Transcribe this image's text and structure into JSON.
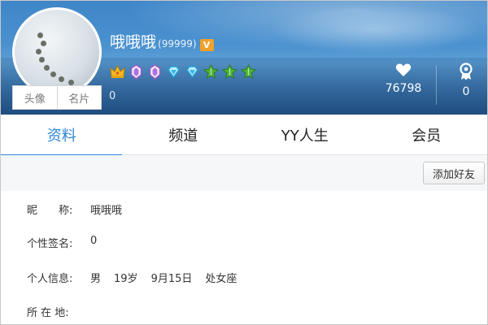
{
  "profile": {
    "username": "哦哦哦",
    "yy_number": "(99999)",
    "v_badge": "V",
    "avatar_tabs": [
      "头像",
      "名片"
    ],
    "left_count": "0",
    "badges": [
      "crown-icon",
      "purple-gem-icon",
      "purple-gem-icon",
      "blue-diamond-icon",
      "blue-diamond-icon",
      "green-leaf-icon",
      "green-leaf-icon",
      "green-leaf-icon"
    ],
    "likes": "76798",
    "medals": "0"
  },
  "tabs": [
    "资料",
    "频道",
    "YY人生",
    "会员"
  ],
  "add_friend_label": "添加好友",
  "info": {
    "nickname_label": "昵　　称:",
    "nickname_value": "哦哦哦",
    "signature_label": "个性签名:",
    "signature_value": "0",
    "personal_label": "个人信息:",
    "gender": "男",
    "age": "19岁",
    "birthday": "9月15日",
    "zodiac": "处女座",
    "location_label": "所 在 地:"
  },
  "colors": {
    "accent": "#2b86d6",
    "header": "#3f86c8"
  }
}
